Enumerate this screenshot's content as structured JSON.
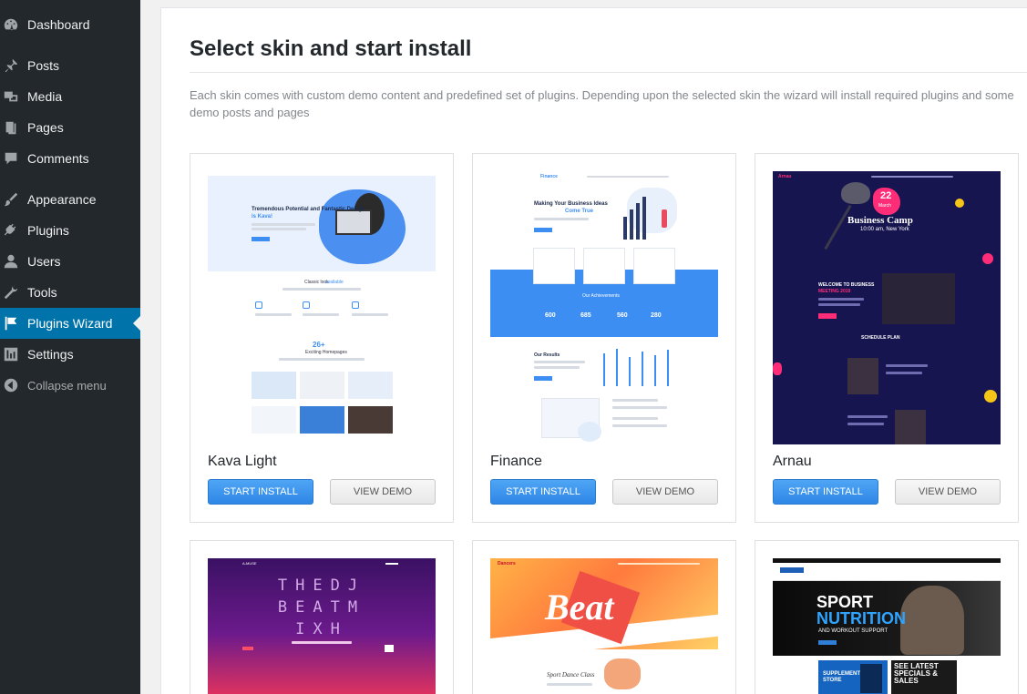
{
  "sidebar": {
    "items": [
      {
        "label": "Dashboard",
        "icon": "dashboard-icon"
      },
      {
        "label": "Posts",
        "icon": "pin-icon"
      },
      {
        "label": "Media",
        "icon": "media-icon"
      },
      {
        "label": "Pages",
        "icon": "pages-icon"
      },
      {
        "label": "Comments",
        "icon": "comment-icon"
      },
      {
        "label": "Appearance",
        "icon": "brush-icon"
      },
      {
        "label": "Plugins",
        "icon": "plug-icon"
      },
      {
        "label": "Users",
        "icon": "user-icon"
      },
      {
        "label": "Tools",
        "icon": "wrench-icon"
      },
      {
        "label": "Plugins Wizard",
        "icon": "flag-icon",
        "current": true
      },
      {
        "label": "Settings",
        "icon": "sliders-icon"
      }
    ],
    "collapse_label": "Collapse menu"
  },
  "main": {
    "title": "Select skin and start install",
    "description": "Each skin comes with custom demo content and predefined set of plugins. Depending upon the selected skin the wizard will install required plugins and some demo posts and pages"
  },
  "skins": [
    {
      "name": "Kava Light",
      "install_label": "START INSTALL",
      "demo_label": "VIEW DEMO"
    },
    {
      "name": "Finance",
      "install_label": "START INSTALL",
      "demo_label": "VIEW DEMO"
    },
    {
      "name": "Arnau",
      "install_label": "START INSTALL",
      "demo_label": "VIEW DEMO"
    }
  ],
  "thumbnails": {
    "kava": {
      "headline": "Tremendous Potential and Fantastic Design",
      "headline_accent": "is Kava!",
      "features_title": "Classic look",
      "features_accent": "available",
      "count": "26+",
      "count_label": "Exciting Homepages"
    },
    "finance": {
      "brand": "Finance",
      "headline": "Making Your Business Ideas",
      "headline_accent": "Come True",
      "achievements_title": "Our Achievements",
      "stats": [
        "600",
        "685",
        "560",
        "280"
      ],
      "results_title": "Our Results"
    },
    "arnau": {
      "brand": "Arnau",
      "date_day": "22",
      "date_month": "March",
      "event_title": "Business Camp",
      "event_time": "10:00 am, New York",
      "welcome_line1": "WELCOME TO BUSINESS",
      "welcome_line2": "MEETING 2019",
      "schedule": "SCHEDULE PLAN"
    },
    "dj": {
      "title": "THEDJ BEATM IXH",
      "brand": "A-MUSE"
    },
    "dance": {
      "brand": "Dancers",
      "title": "Beat",
      "caption": "Sport Dance Class"
    },
    "sport": {
      "title1": "SPORT",
      "title2": "NUTRITION",
      "subtitle": "AND WORKOUT SUPPORT",
      "promo1": "SUPPLEMENT STORE",
      "promo2": "SEE LATEST SPECIALS & SALES"
    }
  },
  "colors": {
    "sidebar_bg": "#23282d",
    "current_item_bg": "#0073aa",
    "install_button": "#3a8ee8",
    "finance_blue": "#3d8ef2",
    "arnau_navy": "#17154f",
    "arnau_pink": "#ff2d78"
  }
}
